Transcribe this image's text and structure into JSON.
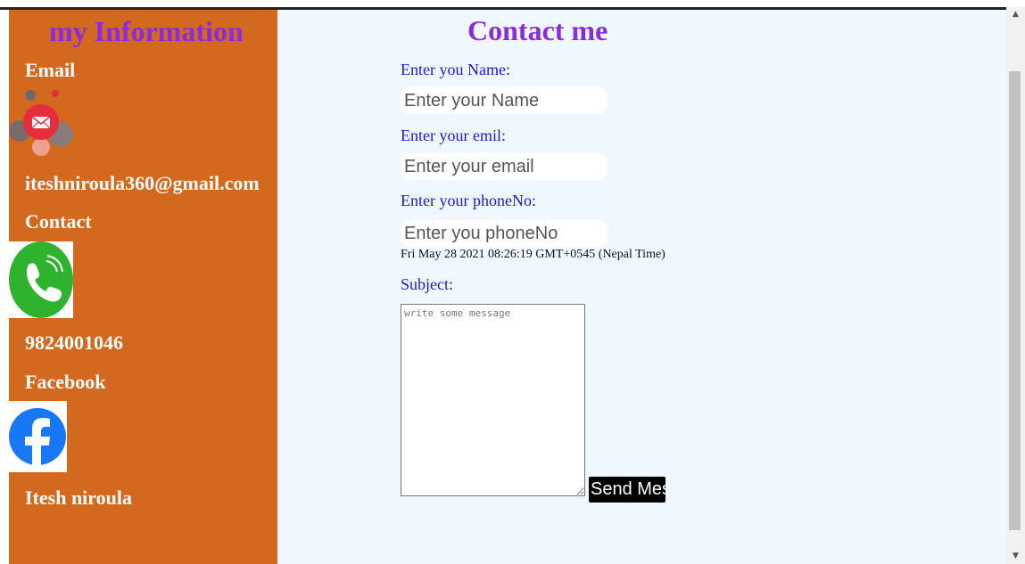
{
  "sidebar": {
    "title": "my Information",
    "email_label": "Email",
    "email_value": "iteshniroula360@gmail.com",
    "contact_label": "Contact",
    "phone_value": "9824001046",
    "facebook_label": "Facebook",
    "facebook_name": "Itesh niroula"
  },
  "main": {
    "title": "Contact me",
    "name_label": "Enter you Name:",
    "name_placeholder": "Enter your Name",
    "email_label": "Enter your emil:",
    "email_placeholder": "Enter your email",
    "phone_label": "Enter your phoneNo:",
    "phone_placeholder": "Enter you phoneNo",
    "datetime": "Fri May 28 2021 08:26:19 GMT+0545 (Nepal Time)",
    "subject_label": "Subject:",
    "message_placeholder": "write some message",
    "send_label": "Send Message"
  },
  "colors": {
    "sidebar_bg": "#d2691e",
    "main_bg": "#f0f8ff",
    "title_purple": "#8a2be2",
    "label_blue": "#1a1ad4"
  },
  "icons": [
    "mail-icon",
    "phone-icon",
    "facebook-icon"
  ]
}
